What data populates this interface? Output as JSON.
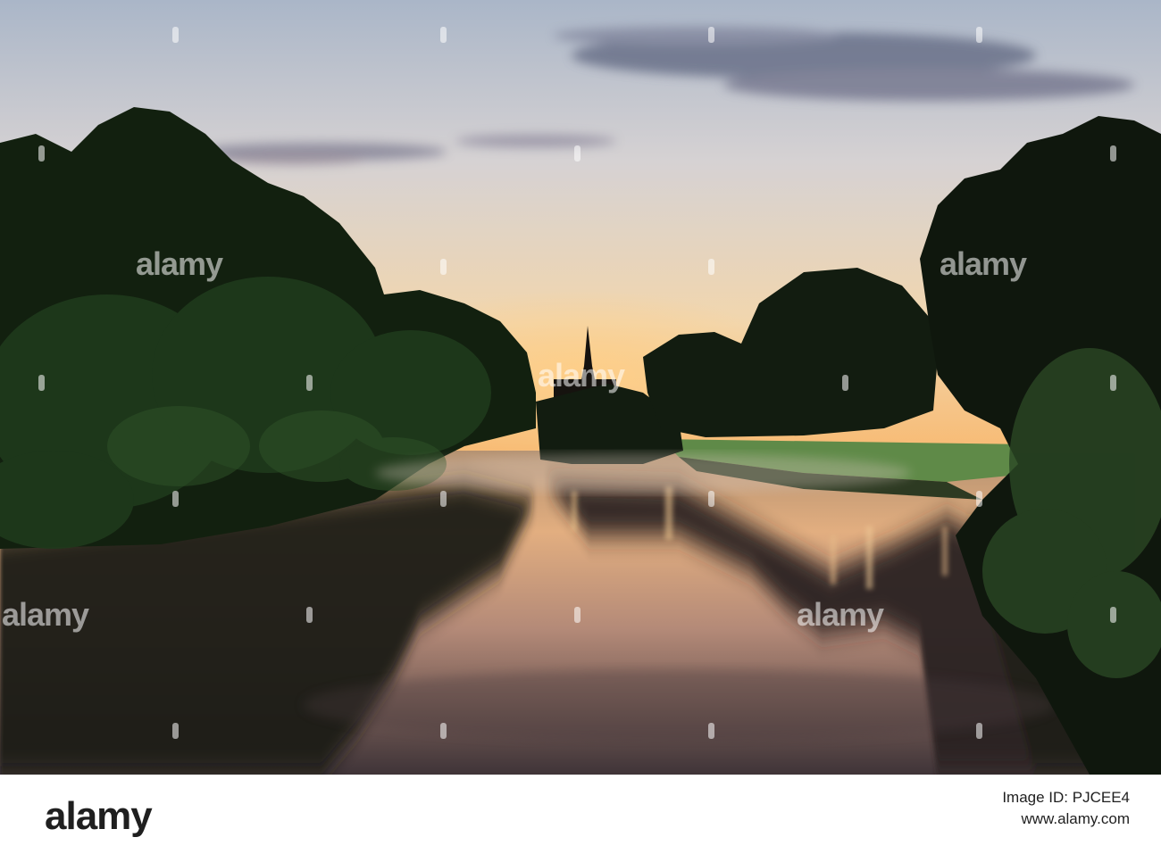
{
  "watermark": {
    "text": "alamy"
  },
  "footer": {
    "logo": "alamy",
    "image_id_label": "Image ID: PJCEE4",
    "image_id_value": "",
    "url": "www.alamy.com"
  },
  "colors": {
    "sky_top": "#b9c3d2",
    "sky_horizon": "#f7c27a",
    "tree_dark": "#132014",
    "grass": "#5b8646",
    "water_glow": "#e7b486",
    "footer_bg": "#ffffff",
    "footer_text": "#1f1f1f"
  }
}
